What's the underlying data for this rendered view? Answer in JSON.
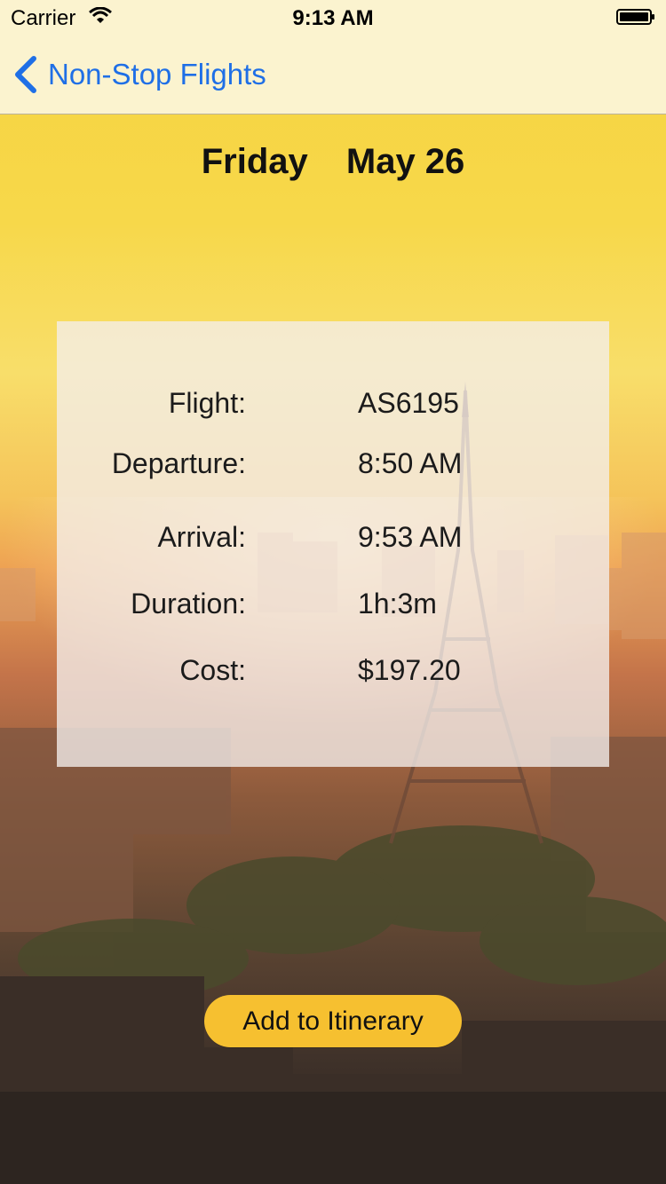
{
  "status_bar": {
    "carrier": "Carrier",
    "time": "9:13 AM"
  },
  "nav": {
    "back_label": "Non-Stop Flights"
  },
  "date": {
    "day": "Friday",
    "date": "May 26"
  },
  "details": [
    {
      "label": "Flight:",
      "value": "AS6195"
    },
    {
      "label": "Departure:",
      "value": "8:50 AM"
    },
    {
      "label": "Arrival:",
      "value": "9:53 AM"
    },
    {
      "label": "Duration:",
      "value": "1h:3m"
    },
    {
      "label": "Cost:",
      "value": "$197.20"
    }
  ],
  "actions": {
    "add_label": "Add to Itinerary"
  },
  "colors": {
    "accent": "#1f6fe6",
    "button": "#f6c030",
    "bar_bg": "#fbf3cf"
  }
}
